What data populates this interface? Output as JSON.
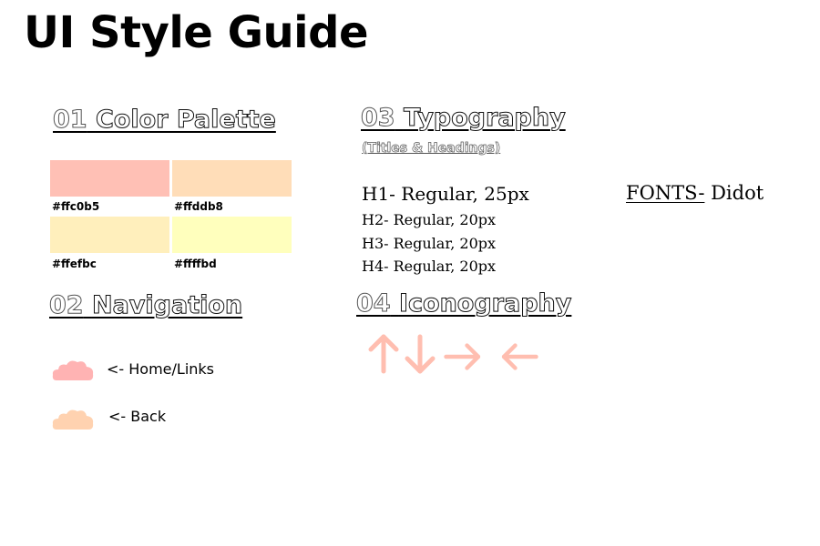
{
  "page": {
    "title": "UI Style Guide"
  },
  "sections": {
    "color": {
      "num": "01",
      "word": "Color Palette"
    },
    "navigation": {
      "num": "02",
      "word": "Navigation"
    },
    "typography": {
      "num": "03",
      "word": "Typography",
      "subtitle": "(Titles & Headings)"
    },
    "iconography": {
      "num": "04",
      "word": "Iconography"
    }
  },
  "palette": [
    {
      "hex": "#ffc0b5",
      "label": "#ffc0b5"
    },
    {
      "hex": "#ffddb8",
      "label": "#ffddb8"
    },
    {
      "hex": "#ffefbc",
      "label": "#ffefbc"
    },
    {
      "hex": "#ffffbd",
      "label": "#ffffbd"
    }
  ],
  "typography": {
    "h1": "H1- Regular, 25px",
    "h2": "H2- Regular, 20px",
    "h3": "H3- Regular, 20px",
    "h4": "H4- Regular, 20px",
    "fonts_label": "FONTS-",
    "fonts_value": " Didot"
  },
  "navigation": {
    "home": {
      "label": "<- Home/Links",
      "icon": "cloud-icon",
      "color": "#ffb3b3"
    },
    "back": {
      "label": "<- Back",
      "icon": "cloud-icon",
      "color": "#ffd2b0"
    }
  },
  "icons": {
    "color": "#ffb8a8",
    "items": [
      "arrow-up-icon",
      "arrow-down-icon",
      "arrow-right-icon",
      "arrow-left-icon"
    ]
  }
}
